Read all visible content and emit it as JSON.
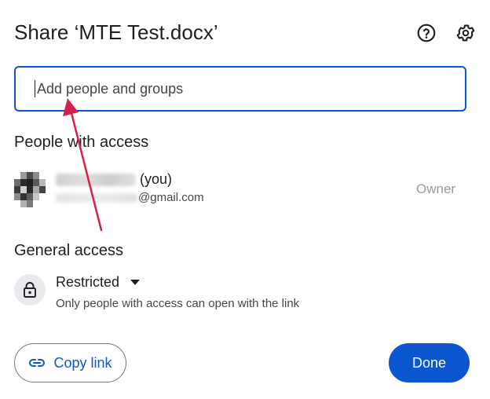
{
  "dialog": {
    "title": "Share ‘MTE Test.docx’",
    "help_icon": "help-circle-icon",
    "settings_icon": "gear-icon"
  },
  "search": {
    "placeholder": "Add people and groups",
    "value": ""
  },
  "people_section": {
    "heading": "People with access",
    "people": [
      {
        "name_suffix": "(you)",
        "email_suffix": "@gmail.com",
        "role": "Owner"
      }
    ]
  },
  "general_access": {
    "heading": "General access",
    "icon": "lock-icon",
    "selected": "Restricted",
    "description": "Only people with access can open with the link"
  },
  "footer": {
    "copy_link_label": "Copy link",
    "copy_link_icon": "link-icon",
    "done_label": "Done"
  },
  "colors": {
    "accent": "#0b57d0",
    "text": "#1f1f1f",
    "secondary_text": "#444746",
    "annotation_arrow": "#d6204a"
  }
}
